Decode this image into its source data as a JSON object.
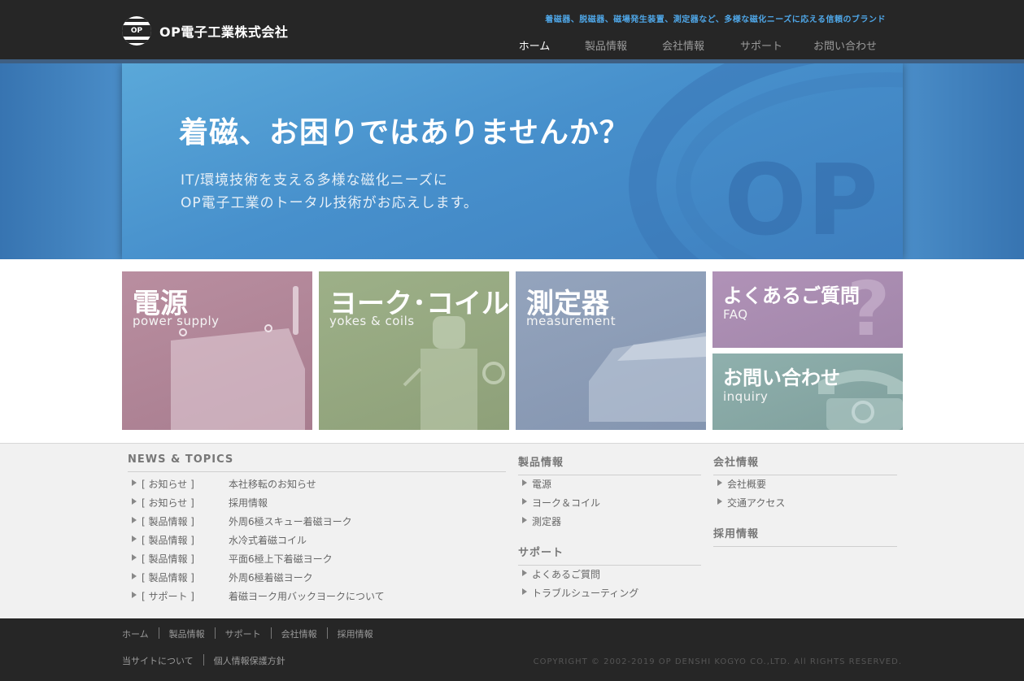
{
  "header": {
    "logo_mark": "OP",
    "company_name": "OP電子工業株式会社",
    "tagline": "着磁器、脱磁器、磁場発生装置、測定器など、多様な磁化ニーズに応える信頼のブランド",
    "nav": [
      {
        "label": "ホーム",
        "active": true
      },
      {
        "label": "製品情報",
        "active": false
      },
      {
        "label": "会社情報",
        "active": false
      },
      {
        "label": "サポート",
        "active": false
      },
      {
        "label": "お問い合わせ",
        "active": false
      }
    ],
    "accent_color": "#4fa7e8"
  },
  "hero": {
    "title": "着磁、お困りではありませんか？",
    "subtitle_line1": "IT/環境技術を支える多様な磁化ニーズに",
    "subtitle_line2": "OP電子工業のトータル技術がお応えします。",
    "watermark": "OP"
  },
  "tiles": [
    {
      "title": "電源",
      "subtitle": "power supply",
      "color": "#b78a9b"
    },
    {
      "title": "ヨーク･コイル",
      "subtitle": "yokes & coils",
      "color": "#98a983"
    },
    {
      "title": "測定器",
      "subtitle": "measurement",
      "color": "#8c9cb7"
    },
    {
      "title": "よくあるご質問",
      "subtitle": "FAQ",
      "color": "#a98db0"
    },
    {
      "title": "お問い合わせ",
      "subtitle": "inquiry",
      "color": "#88a8a6"
    }
  ],
  "news": {
    "title": "NEWS & TOPICS",
    "items": [
      {
        "category": "[ お知らせ ]",
        "text": "本社移転のお知らせ"
      },
      {
        "category": "[ お知らせ ]",
        "text": "採用情報"
      },
      {
        "category": "[ 製品情報 ]",
        "text": "外周6極スキュー着磁ヨーク"
      },
      {
        "category": "[ 製品情報 ]",
        "text": "水冷式着磁コイル"
      },
      {
        "category": "[ 製品情報 ]",
        "text": "平面6極上下着磁ヨーク"
      },
      {
        "category": "[ 製品情報 ]",
        "text": "外周6極着磁ヨーク"
      },
      {
        "category": "[ サポート ]",
        "text": "着磁ヨーク用バックヨークについて"
      }
    ]
  },
  "products": {
    "title": "製品情報",
    "items": [
      "電源",
      "ヨーク＆コイル",
      "測定器"
    ]
  },
  "support": {
    "title": "サポート",
    "items": [
      "よくあるご質問",
      "トラブルシューティング"
    ]
  },
  "company": {
    "title": "会社情報",
    "items": [
      "会社概要",
      "交通アクセス"
    ]
  },
  "recruit": {
    "title": "採用情報"
  },
  "footer": {
    "links_row1": [
      "ホーム",
      "製品情報",
      "サポート",
      "会社情報",
      "採用情報"
    ],
    "links_row2": [
      "当サイトについて",
      "個人情報保護方針"
    ],
    "copyright": "COPYRIGHT © 2002-2019 OP DENSHI KOGYO CO.,LTD. All RIGHTS RESERVED."
  }
}
